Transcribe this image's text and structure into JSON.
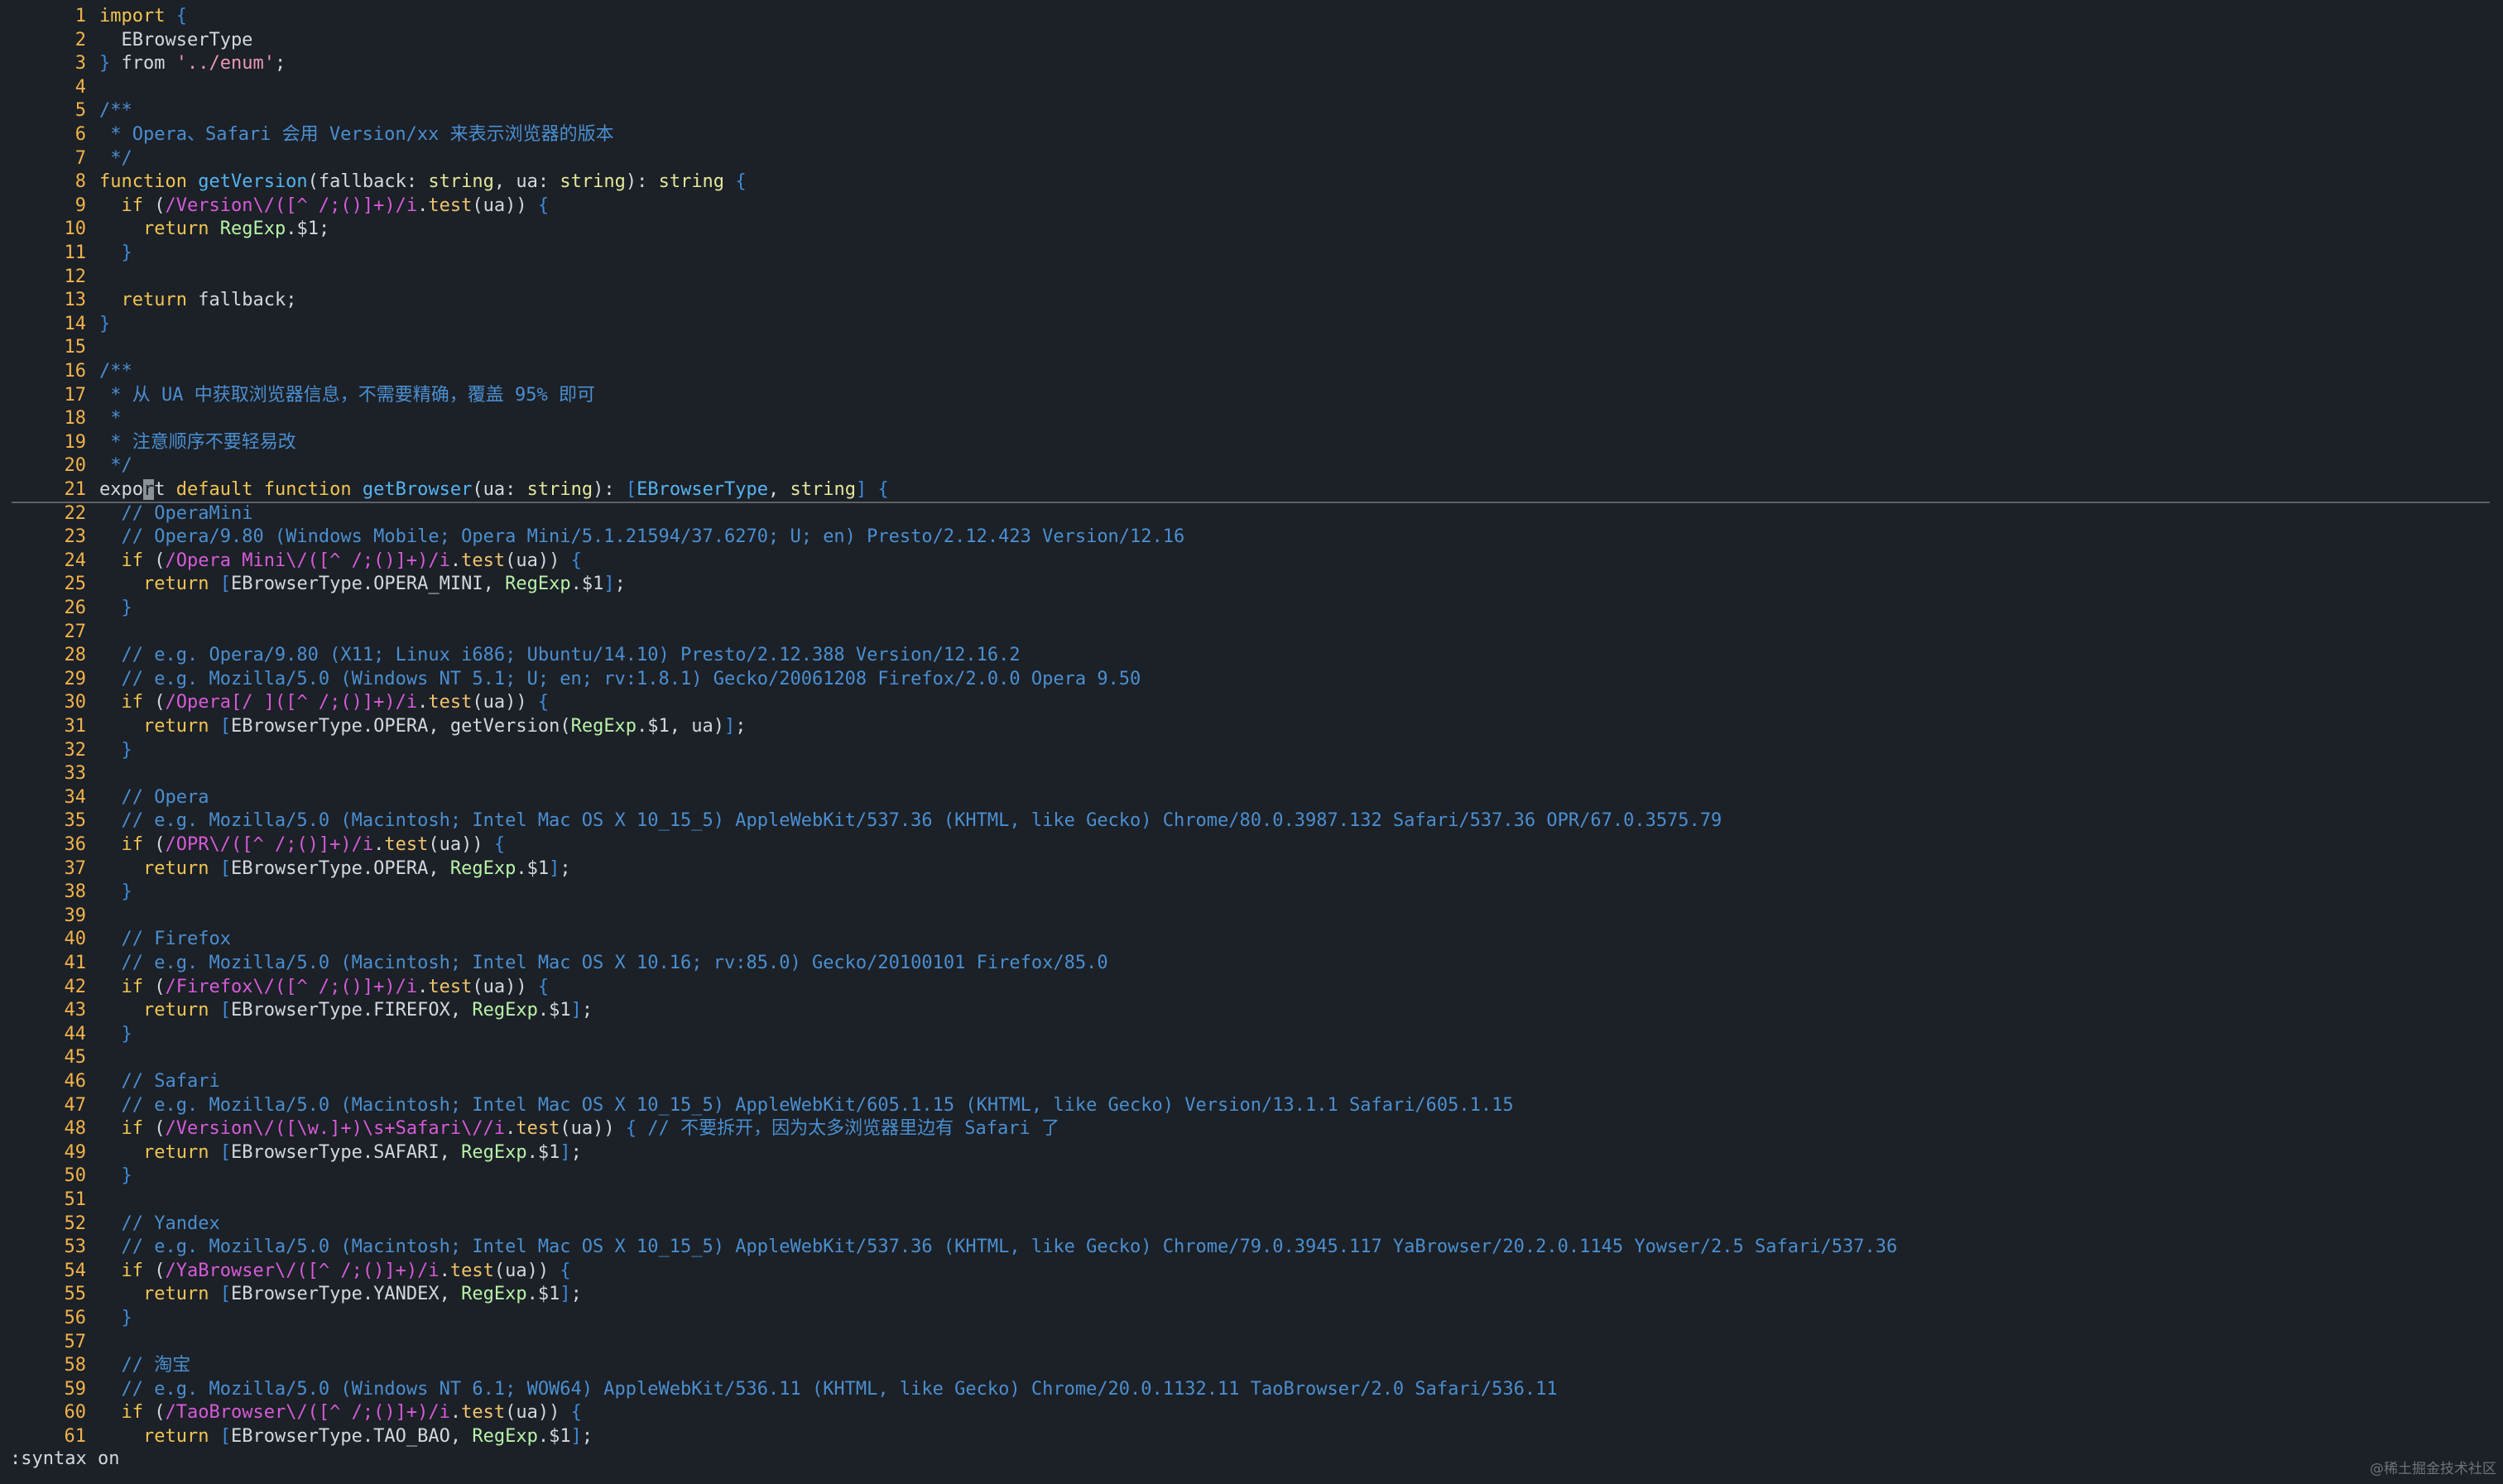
{
  "editor": {
    "lines": [
      {
        "n": "1",
        "tokens": [
          [
            "kw",
            "import"
          ],
          [
            "bl",
            " "
          ],
          [
            "br",
            "{"
          ]
        ]
      },
      {
        "n": "2",
        "tokens": [
          [
            "bl",
            "  EBrowserType"
          ]
        ]
      },
      {
        "n": "3",
        "tokens": [
          [
            "br",
            "}"
          ],
          [
            "bl",
            " from "
          ],
          [
            "str",
            "'../enum'"
          ],
          [
            "bl",
            ";"
          ]
        ]
      },
      {
        "n": "4",
        "tokens": []
      },
      {
        "n": "5",
        "tokens": [
          [
            "cm",
            "/**"
          ]
        ]
      },
      {
        "n": "6",
        "tokens": [
          [
            "cm",
            " * Opera、Safari 会用 Version/xx 来表示浏览器的版本"
          ]
        ]
      },
      {
        "n": "7",
        "tokens": [
          [
            "cm",
            " */"
          ]
        ]
      },
      {
        "n": "8",
        "tokens": [
          [
            "kw",
            "function"
          ],
          [
            "bl",
            " "
          ],
          [
            "fn",
            "getVersion"
          ],
          [
            "bl",
            "(fallback: "
          ],
          [
            "ty",
            "string"
          ],
          [
            "bl",
            ", ua: "
          ],
          [
            "ty",
            "string"
          ],
          [
            "bl",
            "): "
          ],
          [
            "ty",
            "string"
          ],
          [
            "bl",
            " "
          ],
          [
            "br",
            "{"
          ]
        ]
      },
      {
        "n": "9",
        "tokens": [
          [
            "bl",
            "  "
          ],
          [
            "kw",
            "if"
          ],
          [
            "bl",
            " ("
          ],
          [
            "rx",
            "/Version\\/([^ /;()]+)/i"
          ],
          [
            "bl",
            "."
          ],
          [
            "mt",
            "test"
          ],
          [
            "bl",
            "(ua)) "
          ],
          [
            "br",
            "{"
          ]
        ]
      },
      {
        "n": "10",
        "tokens": [
          [
            "bl",
            "    "
          ],
          [
            "kw",
            "return"
          ],
          [
            "bl",
            " "
          ],
          [
            "obj",
            "RegExp"
          ],
          [
            "bl",
            ".$1;"
          ]
        ]
      },
      {
        "n": "11",
        "tokens": [
          [
            "bl",
            "  "
          ],
          [
            "br",
            "}"
          ]
        ]
      },
      {
        "n": "12",
        "tokens": []
      },
      {
        "n": "13",
        "tokens": [
          [
            "bl",
            "  "
          ],
          [
            "kw",
            "return"
          ],
          [
            "bl",
            " fallback;"
          ]
        ]
      },
      {
        "n": "14",
        "tokens": [
          [
            "br",
            "}"
          ]
        ]
      },
      {
        "n": "15",
        "tokens": []
      },
      {
        "n": "16",
        "tokens": [
          [
            "cm",
            "/**"
          ]
        ]
      },
      {
        "n": "17",
        "tokens": [
          [
            "cm",
            " * 从 UA 中获取浏览器信息，不需要精确，覆盖 95% 即可"
          ]
        ]
      },
      {
        "n": "18",
        "tokens": [
          [
            "cm",
            " *"
          ]
        ]
      },
      {
        "n": "19",
        "tokens": [
          [
            "cm",
            " * 注意顺序不要轻易改"
          ]
        ]
      },
      {
        "n": "20",
        "tokens": [
          [
            "cm",
            " */"
          ]
        ]
      },
      {
        "n": "21",
        "tokens": [
          [
            "bl",
            "expo"
          ],
          [
            "cursor",
            "r"
          ],
          [
            "bl",
            "t "
          ],
          [
            "kw",
            "default"
          ],
          [
            "bl",
            " "
          ],
          [
            "kw",
            "function"
          ],
          [
            "bl",
            " "
          ],
          [
            "fn",
            "getBrowser"
          ],
          [
            "bl",
            "(ua: "
          ],
          [
            "ty",
            "string"
          ],
          [
            "bl",
            "): "
          ],
          [
            "br",
            "["
          ],
          [
            "fn",
            "EBrowserType"
          ],
          [
            "bl",
            ", "
          ],
          [
            "ty",
            "string"
          ],
          [
            "br",
            "]"
          ],
          [
            "bl",
            " "
          ],
          [
            "br",
            "{"
          ]
        ]
      },
      {
        "n": "22",
        "tokens": [
          [
            "bl",
            "  "
          ],
          [
            "cm",
            "// OperaMini"
          ]
        ]
      },
      {
        "n": "23",
        "tokens": [
          [
            "bl",
            "  "
          ],
          [
            "cm",
            "// Opera/9.80 (Windows Mobile; Opera Mini/5.1.21594/37.6270; U; en) Presto/2.12.423 Version/12.16"
          ]
        ]
      },
      {
        "n": "24",
        "tokens": [
          [
            "bl",
            "  "
          ],
          [
            "kw",
            "if"
          ],
          [
            "bl",
            " ("
          ],
          [
            "rx",
            "/Opera Mini\\/([^ /;()]+)/i"
          ],
          [
            "bl",
            "."
          ],
          [
            "mt",
            "test"
          ],
          [
            "bl",
            "(ua)) "
          ],
          [
            "br",
            "{"
          ]
        ]
      },
      {
        "n": "25",
        "tokens": [
          [
            "bl",
            "    "
          ],
          [
            "kw",
            "return"
          ],
          [
            "bl",
            " "
          ],
          [
            "br",
            "["
          ],
          [
            "bl",
            "EBrowserType.OPERA_MINI, "
          ],
          [
            "obj",
            "RegExp"
          ],
          [
            "bl",
            ".$1"
          ],
          [
            "br",
            "]"
          ],
          [
            "bl",
            ";"
          ]
        ]
      },
      {
        "n": "26",
        "tokens": [
          [
            "bl",
            "  "
          ],
          [
            "br",
            "}"
          ]
        ]
      },
      {
        "n": "27",
        "tokens": []
      },
      {
        "n": "28",
        "tokens": [
          [
            "bl",
            "  "
          ],
          [
            "cm",
            "// e.g. Opera/9.80 (X11; Linux i686; Ubuntu/14.10) Presto/2.12.388 Version/12.16.2"
          ]
        ]
      },
      {
        "n": "29",
        "tokens": [
          [
            "bl",
            "  "
          ],
          [
            "cm",
            "// e.g. Mozilla/5.0 (Windows NT 5.1; U; en; rv:1.8.1) Gecko/20061208 Firefox/2.0.0 Opera 9.50"
          ]
        ]
      },
      {
        "n": "30",
        "tokens": [
          [
            "bl",
            "  "
          ],
          [
            "kw",
            "if"
          ],
          [
            "bl",
            " ("
          ],
          [
            "rx",
            "/Opera[/ ]([^ /;()]+)/i"
          ],
          [
            "bl",
            "."
          ],
          [
            "mt",
            "test"
          ],
          [
            "bl",
            "(ua)) "
          ],
          [
            "br",
            "{"
          ]
        ]
      },
      {
        "n": "31",
        "tokens": [
          [
            "bl",
            "    "
          ],
          [
            "kw",
            "return"
          ],
          [
            "bl",
            " "
          ],
          [
            "br",
            "["
          ],
          [
            "bl",
            "EBrowserType.OPERA, getVersion("
          ],
          [
            "obj",
            "RegExp"
          ],
          [
            "bl",
            ".$1, ua)"
          ],
          [
            "br",
            "]"
          ],
          [
            "bl",
            ";"
          ]
        ]
      },
      {
        "n": "32",
        "tokens": [
          [
            "bl",
            "  "
          ],
          [
            "br",
            "}"
          ]
        ]
      },
      {
        "n": "33",
        "tokens": []
      },
      {
        "n": "34",
        "tokens": [
          [
            "bl",
            "  "
          ],
          [
            "cm",
            "// Opera"
          ]
        ]
      },
      {
        "n": "35",
        "tokens": [
          [
            "bl",
            "  "
          ],
          [
            "cm",
            "// e.g. Mozilla/5.0 (Macintosh; Intel Mac OS X 10_15_5) AppleWebKit/537.36 (KHTML, like Gecko) Chrome/80.0.3987.132 Safari/537.36 OPR/67.0.3575.79"
          ]
        ]
      },
      {
        "n": "36",
        "tokens": [
          [
            "bl",
            "  "
          ],
          [
            "kw",
            "if"
          ],
          [
            "bl",
            " ("
          ],
          [
            "rx",
            "/OPR\\/([^ /;()]+)/i"
          ],
          [
            "bl",
            "."
          ],
          [
            "mt",
            "test"
          ],
          [
            "bl",
            "(ua)) "
          ],
          [
            "br",
            "{"
          ]
        ]
      },
      {
        "n": "37",
        "tokens": [
          [
            "bl",
            "    "
          ],
          [
            "kw",
            "return"
          ],
          [
            "bl",
            " "
          ],
          [
            "br",
            "["
          ],
          [
            "bl",
            "EBrowserType.OPERA, "
          ],
          [
            "obj",
            "RegExp"
          ],
          [
            "bl",
            ".$1"
          ],
          [
            "br",
            "]"
          ],
          [
            "bl",
            ";"
          ]
        ]
      },
      {
        "n": "38",
        "tokens": [
          [
            "bl",
            "  "
          ],
          [
            "br",
            "}"
          ]
        ]
      },
      {
        "n": "39",
        "tokens": []
      },
      {
        "n": "40",
        "tokens": [
          [
            "bl",
            "  "
          ],
          [
            "cm",
            "// Firefox"
          ]
        ]
      },
      {
        "n": "41",
        "tokens": [
          [
            "bl",
            "  "
          ],
          [
            "cm",
            "// e.g. Mozilla/5.0 (Macintosh; Intel Mac OS X 10.16; rv:85.0) Gecko/20100101 Firefox/85.0"
          ]
        ]
      },
      {
        "n": "42",
        "tokens": [
          [
            "bl",
            "  "
          ],
          [
            "kw",
            "if"
          ],
          [
            "bl",
            " ("
          ],
          [
            "rx",
            "/Firefox\\/([^ /;()]+)/i"
          ],
          [
            "bl",
            "."
          ],
          [
            "mt",
            "test"
          ],
          [
            "bl",
            "(ua)) "
          ],
          [
            "br",
            "{"
          ]
        ]
      },
      {
        "n": "43",
        "tokens": [
          [
            "bl",
            "    "
          ],
          [
            "kw",
            "return"
          ],
          [
            "bl",
            " "
          ],
          [
            "br",
            "["
          ],
          [
            "bl",
            "EBrowserType.FIREFOX, "
          ],
          [
            "obj",
            "RegExp"
          ],
          [
            "bl",
            ".$1"
          ],
          [
            "br",
            "]"
          ],
          [
            "bl",
            ";"
          ]
        ]
      },
      {
        "n": "44",
        "tokens": [
          [
            "bl",
            "  "
          ],
          [
            "br",
            "}"
          ]
        ]
      },
      {
        "n": "45",
        "tokens": []
      },
      {
        "n": "46",
        "tokens": [
          [
            "bl",
            "  "
          ],
          [
            "cm",
            "// Safari"
          ]
        ]
      },
      {
        "n": "47",
        "tokens": [
          [
            "bl",
            "  "
          ],
          [
            "cm",
            "// e.g. Mozilla/5.0 (Macintosh; Intel Mac OS X 10_15_5) AppleWebKit/605.1.15 (KHTML, like Gecko) Version/13.1.1 Safari/605.1.15"
          ]
        ]
      },
      {
        "n": "48",
        "tokens": [
          [
            "bl",
            "  "
          ],
          [
            "kw",
            "if"
          ],
          [
            "bl",
            " ("
          ],
          [
            "rx",
            "/Version\\/([\\w.]+)\\s+Safari\\//i"
          ],
          [
            "bl",
            "."
          ],
          [
            "mt",
            "test"
          ],
          [
            "bl",
            "(ua)) "
          ],
          [
            "br",
            "{"
          ],
          [
            "bl",
            " "
          ],
          [
            "cm",
            "// 不要拆开，因为太多浏览器里边有 Safari 了"
          ]
        ]
      },
      {
        "n": "49",
        "tokens": [
          [
            "bl",
            "    "
          ],
          [
            "kw",
            "return"
          ],
          [
            "bl",
            " "
          ],
          [
            "br",
            "["
          ],
          [
            "bl",
            "EBrowserType.SAFARI, "
          ],
          [
            "obj",
            "RegExp"
          ],
          [
            "bl",
            ".$1"
          ],
          [
            "br",
            "]"
          ],
          [
            "bl",
            ";"
          ]
        ]
      },
      {
        "n": "50",
        "tokens": [
          [
            "bl",
            "  "
          ],
          [
            "br",
            "}"
          ]
        ]
      },
      {
        "n": "51",
        "tokens": []
      },
      {
        "n": "52",
        "tokens": [
          [
            "bl",
            "  "
          ],
          [
            "cm",
            "// Yandex"
          ]
        ]
      },
      {
        "n": "53",
        "tokens": [
          [
            "bl",
            "  "
          ],
          [
            "cm",
            "// e.g. Mozilla/5.0 (Macintosh; Intel Mac OS X 10_15_5) AppleWebKit/537.36 (KHTML, like Gecko) Chrome/79.0.3945.117 YaBrowser/20.2.0.1145 Yowser/2.5 Safari/537.36"
          ]
        ]
      },
      {
        "n": "54",
        "tokens": [
          [
            "bl",
            "  "
          ],
          [
            "kw",
            "if"
          ],
          [
            "bl",
            " ("
          ],
          [
            "rx",
            "/YaBrowser\\/([^ /;()]+)/i"
          ],
          [
            "bl",
            "."
          ],
          [
            "mt",
            "test"
          ],
          [
            "bl",
            "(ua)) "
          ],
          [
            "br",
            "{"
          ]
        ]
      },
      {
        "n": "55",
        "tokens": [
          [
            "bl",
            "    "
          ],
          [
            "kw",
            "return"
          ],
          [
            "bl",
            " "
          ],
          [
            "br",
            "["
          ],
          [
            "bl",
            "EBrowserType.YANDEX, "
          ],
          [
            "obj",
            "RegExp"
          ],
          [
            "bl",
            ".$1"
          ],
          [
            "br",
            "]"
          ],
          [
            "bl",
            ";"
          ]
        ]
      },
      {
        "n": "56",
        "tokens": [
          [
            "bl",
            "  "
          ],
          [
            "br",
            "}"
          ]
        ]
      },
      {
        "n": "57",
        "tokens": []
      },
      {
        "n": "58",
        "tokens": [
          [
            "bl",
            "  "
          ],
          [
            "cm",
            "// 淘宝"
          ]
        ]
      },
      {
        "n": "59",
        "tokens": [
          [
            "bl",
            "  "
          ],
          [
            "cm",
            "// e.g. Mozilla/5.0 (Windows NT 6.1; WOW64) AppleWebKit/536.11 (KHTML, like Gecko) Chrome/20.0.1132.11 TaoBrowser/2.0 Safari/536.11"
          ]
        ]
      },
      {
        "n": "60",
        "tokens": [
          [
            "bl",
            "  "
          ],
          [
            "kw",
            "if"
          ],
          [
            "bl",
            " ("
          ],
          [
            "rx",
            "/TaoBrowser\\/([^ /;()]+)/i"
          ],
          [
            "bl",
            "."
          ],
          [
            "mt",
            "test"
          ],
          [
            "bl",
            "(ua)) "
          ],
          [
            "br",
            "{"
          ]
        ]
      },
      {
        "n": "61",
        "tokens": [
          [
            "bl",
            "    "
          ],
          [
            "kw",
            "return"
          ],
          [
            "bl",
            " "
          ],
          [
            "br",
            "["
          ],
          [
            "bl",
            "EBrowserType.TAO_BAO, "
          ],
          [
            "obj",
            "RegExp"
          ],
          [
            "bl",
            ".$1"
          ],
          [
            "br",
            "]"
          ],
          [
            "bl",
            ";"
          ]
        ]
      }
    ],
    "cursor_line": "21"
  },
  "cmdline": ":syntax on",
  "watermark": "@稀土掘金技术社区",
  "colors": {
    "background": "#1c2027",
    "line_number": "#f2b34a",
    "keyword": "#f0c552",
    "function": "#56b4f0",
    "comment": "#4a8fd0",
    "regex": "#d65bd8",
    "type": "#e3e79a",
    "object": "#b7f2a8"
  }
}
